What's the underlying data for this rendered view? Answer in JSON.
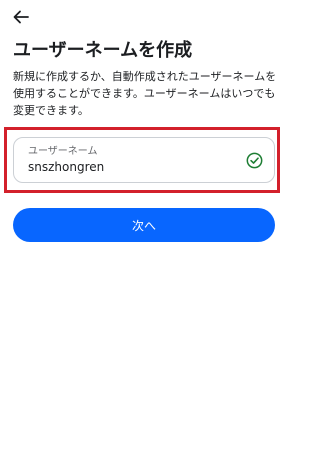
{
  "header": {
    "back_icon": "arrow-left-icon"
  },
  "page": {
    "title": "ユーザーネームを作成",
    "description": "新規に作成するか、自動作成されたユーザーネームを使用することができます。ユーザーネームはいつでも変更できます。"
  },
  "username_field": {
    "label": "ユーザーネーム",
    "value": "snszhongren",
    "status_icon": "check-circle-icon",
    "status_color": "#1e7e34"
  },
  "actions": {
    "next_label": "次へ",
    "accent_color": "#0866ff"
  },
  "annotation": {
    "highlight_color": "#d3202b"
  }
}
